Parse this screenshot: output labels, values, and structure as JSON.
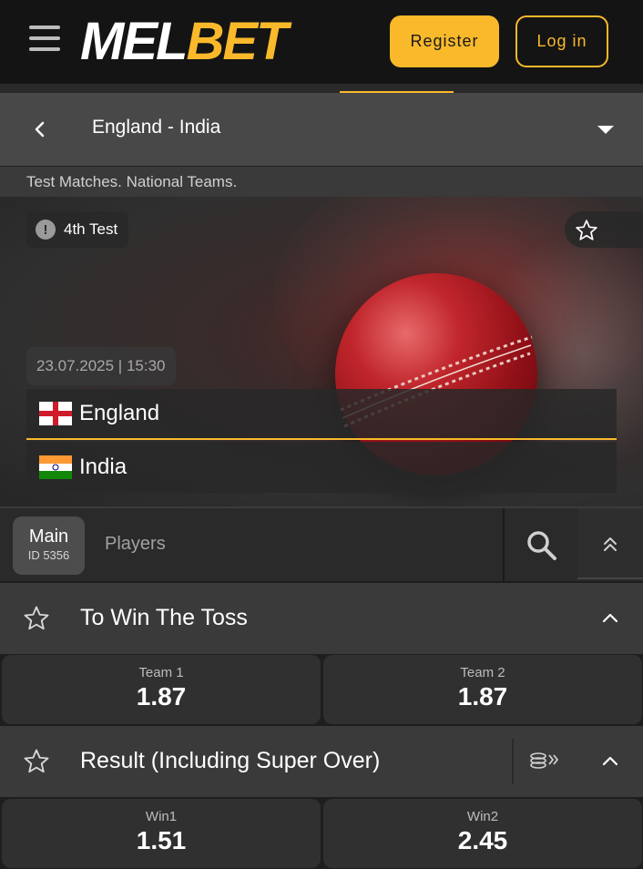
{
  "header": {
    "logo_mel": "MEL",
    "logo_bet": "BET",
    "register_label": "Register",
    "login_label": "Log in"
  },
  "match": {
    "title": "England - India",
    "league": "Test Matches. National Teams.",
    "stage": "4th Test",
    "datetime": "23.07.2025 | 15:30",
    "team1": "England",
    "team2": "India"
  },
  "tabs": {
    "main_label": "Main",
    "main_id": "ID 5356",
    "players_label": "Players"
  },
  "markets": [
    {
      "title": "To Win The Toss",
      "outcomes": [
        {
          "label": "Team 1",
          "odd": "1.87"
        },
        {
          "label": "Team 2",
          "odd": "1.87"
        }
      ]
    },
    {
      "title": "Result (Including Super Over)",
      "outcomes": [
        {
          "label": "Win1",
          "odd": "1.51"
        },
        {
          "label": "Win2",
          "odd": "2.45"
        }
      ]
    }
  ],
  "colors": {
    "accent": "#f9b92b",
    "background": "#1e1e1e",
    "panel": "#3a3a3a"
  },
  "icons": [
    "menu-icon",
    "back-icon",
    "dropdown-icon",
    "info-icon",
    "star-icon",
    "search-icon",
    "collapse-all-icon",
    "chevron-up-icon",
    "coins-icon"
  ]
}
